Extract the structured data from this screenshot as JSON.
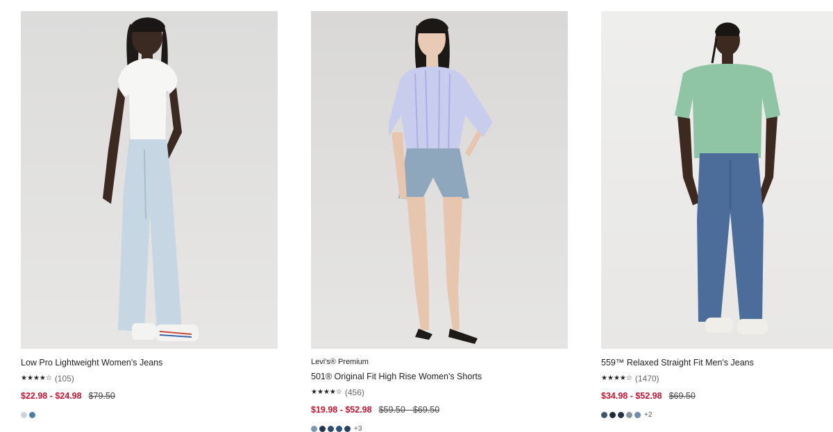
{
  "products": [
    {
      "brand": "",
      "name": "Low Pro Lightweight Women's Jeans",
      "rating_stars": 4,
      "review_count": "(105)",
      "sale_price": "$22.98 - $24.98",
      "original_price": "$79.50",
      "swatches": [
        "#c9d4df",
        "#4f7fa8"
      ],
      "more_swatches": ""
    },
    {
      "brand": "Levi's® Premium",
      "name": "501® Original Fit High Rise Women's Shorts",
      "rating_stars": 4,
      "review_count": "(456)",
      "sale_price": "$19.98 - $52.98",
      "original_price": "$59.50 - $69.50",
      "swatches": [
        "#7d96b0",
        "#23344f",
        "#2d4a73",
        "#30507e",
        "#2a3f63"
      ],
      "more_swatches": "+3"
    },
    {
      "brand": "",
      "name": "559™ Relaxed Straight Fit Men's Jeans",
      "rating_stars": 4,
      "review_count": "(1470)",
      "sale_price": "$34.98 - $52.98",
      "original_price": "$69.50",
      "swatches": [
        "#3d5573",
        "#1d2a3d",
        "#263447",
        "#8a949e",
        "#6d8bab"
      ],
      "more_swatches": "+2"
    }
  ],
  "colors": {
    "sale": "#c41230",
    "text": "#222222",
    "muted": "#666666",
    "photo_bg": "#e9e8e6"
  }
}
